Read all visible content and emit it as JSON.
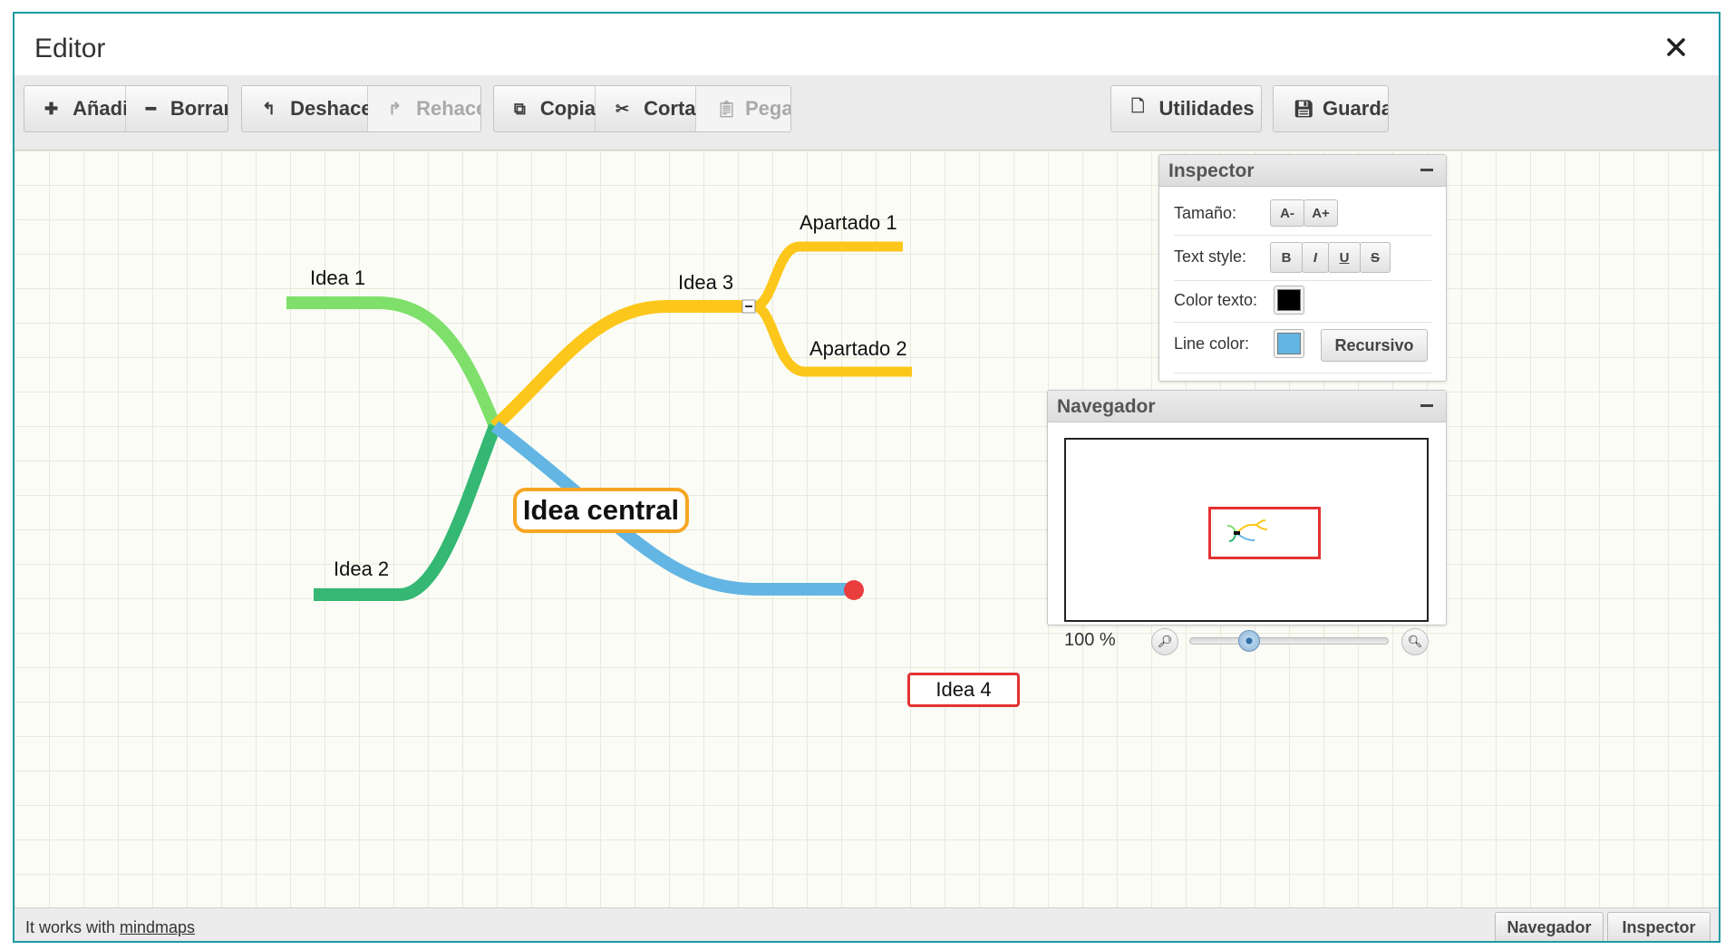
{
  "window": {
    "title": "Editor"
  },
  "toolbar": {
    "add": "Añadir",
    "delete": "Borrar",
    "undo": "Deshacer",
    "redo": "Rehacer",
    "copy": "Copiar",
    "cut": "Cortar",
    "paste": "Pegar",
    "utilities": "Utilidades",
    "save": "Guardar"
  },
  "mindmap": {
    "central": "Idea central",
    "nodes": {
      "idea1": "Idea 1",
      "idea2": "Idea 2",
      "idea3": "Idea 3",
      "idea4": "Idea 4",
      "apartado1": "Apartado 1",
      "apartado2": "Apartado 2"
    },
    "branch_colors": {
      "idea1": "#7ee06a",
      "idea2": "#34b873",
      "idea3": "#fcc71a",
      "idea4": "#63b5e3"
    },
    "selected": "idea4"
  },
  "inspector": {
    "title": "Inspector",
    "size_label": "Tamaño:",
    "size_down": "A-",
    "size_up": "A+",
    "text_style_label": "Text style:",
    "bold": "B",
    "italic": "I",
    "underline": "U",
    "strike": "S",
    "text_color_label": "Color texto:",
    "text_color": "#000000",
    "line_color_label": "Line color:",
    "line_color": "#63b5e3",
    "recursive": "Recursivo"
  },
  "navigator": {
    "title": "Navegador",
    "zoom": "100 %",
    "zoom_level": 0.27
  },
  "statusbar": {
    "text": "It works with ",
    "link": "mindmaps",
    "navigator_btn": "Navegador",
    "inspector_btn": "Inspector"
  }
}
